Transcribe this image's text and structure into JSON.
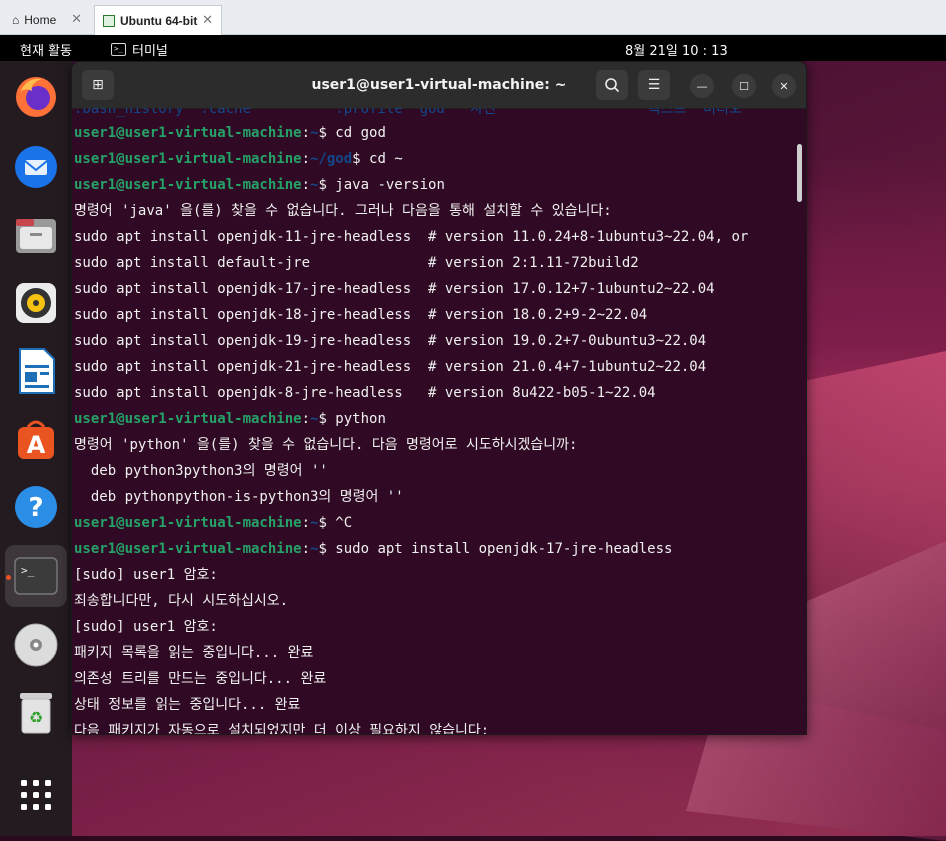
{
  "vm_tabs": {
    "home_label": "Home",
    "active_label": "Ubuntu 64-bit"
  },
  "topbar": {
    "activities": "현재 활동",
    "app_name": "터미널",
    "clock": "8월 21일  10 : 13"
  },
  "dock": {
    "items": [
      "firefox-icon",
      "thunderbird-icon",
      "files-icon",
      "rhythmbox-icon",
      "writer-icon",
      "software-icon",
      "help-icon",
      "terminal-icon",
      "cd-icon",
      "trash-icon",
      "app-grid-icon"
    ]
  },
  "terminal": {
    "title": "user1@user1-virtual-machine: ~",
    "partial_top": ".bash_history  .cache          .profile  god   사진                  텍스트  비디오",
    "lines": [
      {
        "prompt_user": "user1@user1-virtual-machine",
        "prompt_path": "~",
        "cmd": "$ cd god"
      },
      {
        "prompt_user": "user1@user1-virtual-machine",
        "prompt_path": "~/god",
        "cmd": "$ cd ~"
      },
      {
        "prompt_user": "user1@user1-virtual-machine",
        "prompt_path": "~",
        "cmd": "$ java -version"
      },
      {
        "text": "명령어 'java' 을(를) 찾을 수 없습니다. 그러나 다음을 통해 설치할 수 있습니다:"
      },
      {
        "text": "sudo apt install openjdk-11-jre-headless  # version 11.0.24+8-1ubuntu3~22.04, or"
      },
      {
        "text": "sudo apt install default-jre              # version 2:1.11-72build2"
      },
      {
        "text": "sudo apt install openjdk-17-jre-headless  # version 17.0.12+7-1ubuntu2~22.04"
      },
      {
        "text": "sudo apt install openjdk-18-jre-headless  # version 18.0.2+9-2~22.04"
      },
      {
        "text": "sudo apt install openjdk-19-jre-headless  # version 19.0.2+7-0ubuntu3~22.04"
      },
      {
        "text": "sudo apt install openjdk-21-jre-headless  # version 21.0.4+7-1ubuntu2~22.04"
      },
      {
        "text": "sudo apt install openjdk-8-jre-headless   # version 8u422-b05-1~22.04"
      },
      {
        "prompt_user": "user1@user1-virtual-machine",
        "prompt_path": "~",
        "cmd": "$ python"
      },
      {
        "text": "명령어 'python' 을(를) 찾을 수 없습니다. 다음 명령어로 시도하시겠습니까:"
      },
      {
        "text": "  deb python3python3의 명령어 ''"
      },
      {
        "text": "  deb pythonpython-is-python3의 명령어 ''"
      },
      {
        "prompt_user": "user1@user1-virtual-machine",
        "prompt_path": "~",
        "cmd": "$ ^C"
      },
      {
        "prompt_user": "user1@user1-virtual-machine",
        "prompt_path": "~",
        "cmd": "$ sudo apt install openjdk-17-jre-headless"
      },
      {
        "text": "[sudo] user1 암호:"
      },
      {
        "text": "죄송합니다만, 다시 시도하십시오."
      },
      {
        "text": "[sudo] user1 암호:"
      },
      {
        "text": "패키지 목록을 읽는 중입니다... 완료"
      },
      {
        "text": "의존성 트리를 만드는 중입니다... 완료"
      },
      {
        "text": "상태 정보를 읽는 중입니다... 완료"
      },
      {
        "text": "다음 패키지가 자동으로 설치되었지만 더 이상 필요하지 않습니다:"
      }
    ]
  },
  "colors": {
    "terminal_bg": "#300a24",
    "prompt_user": "#26a269",
    "prompt_path": "#12488b",
    "ubuntu_orange": "#e95420"
  }
}
